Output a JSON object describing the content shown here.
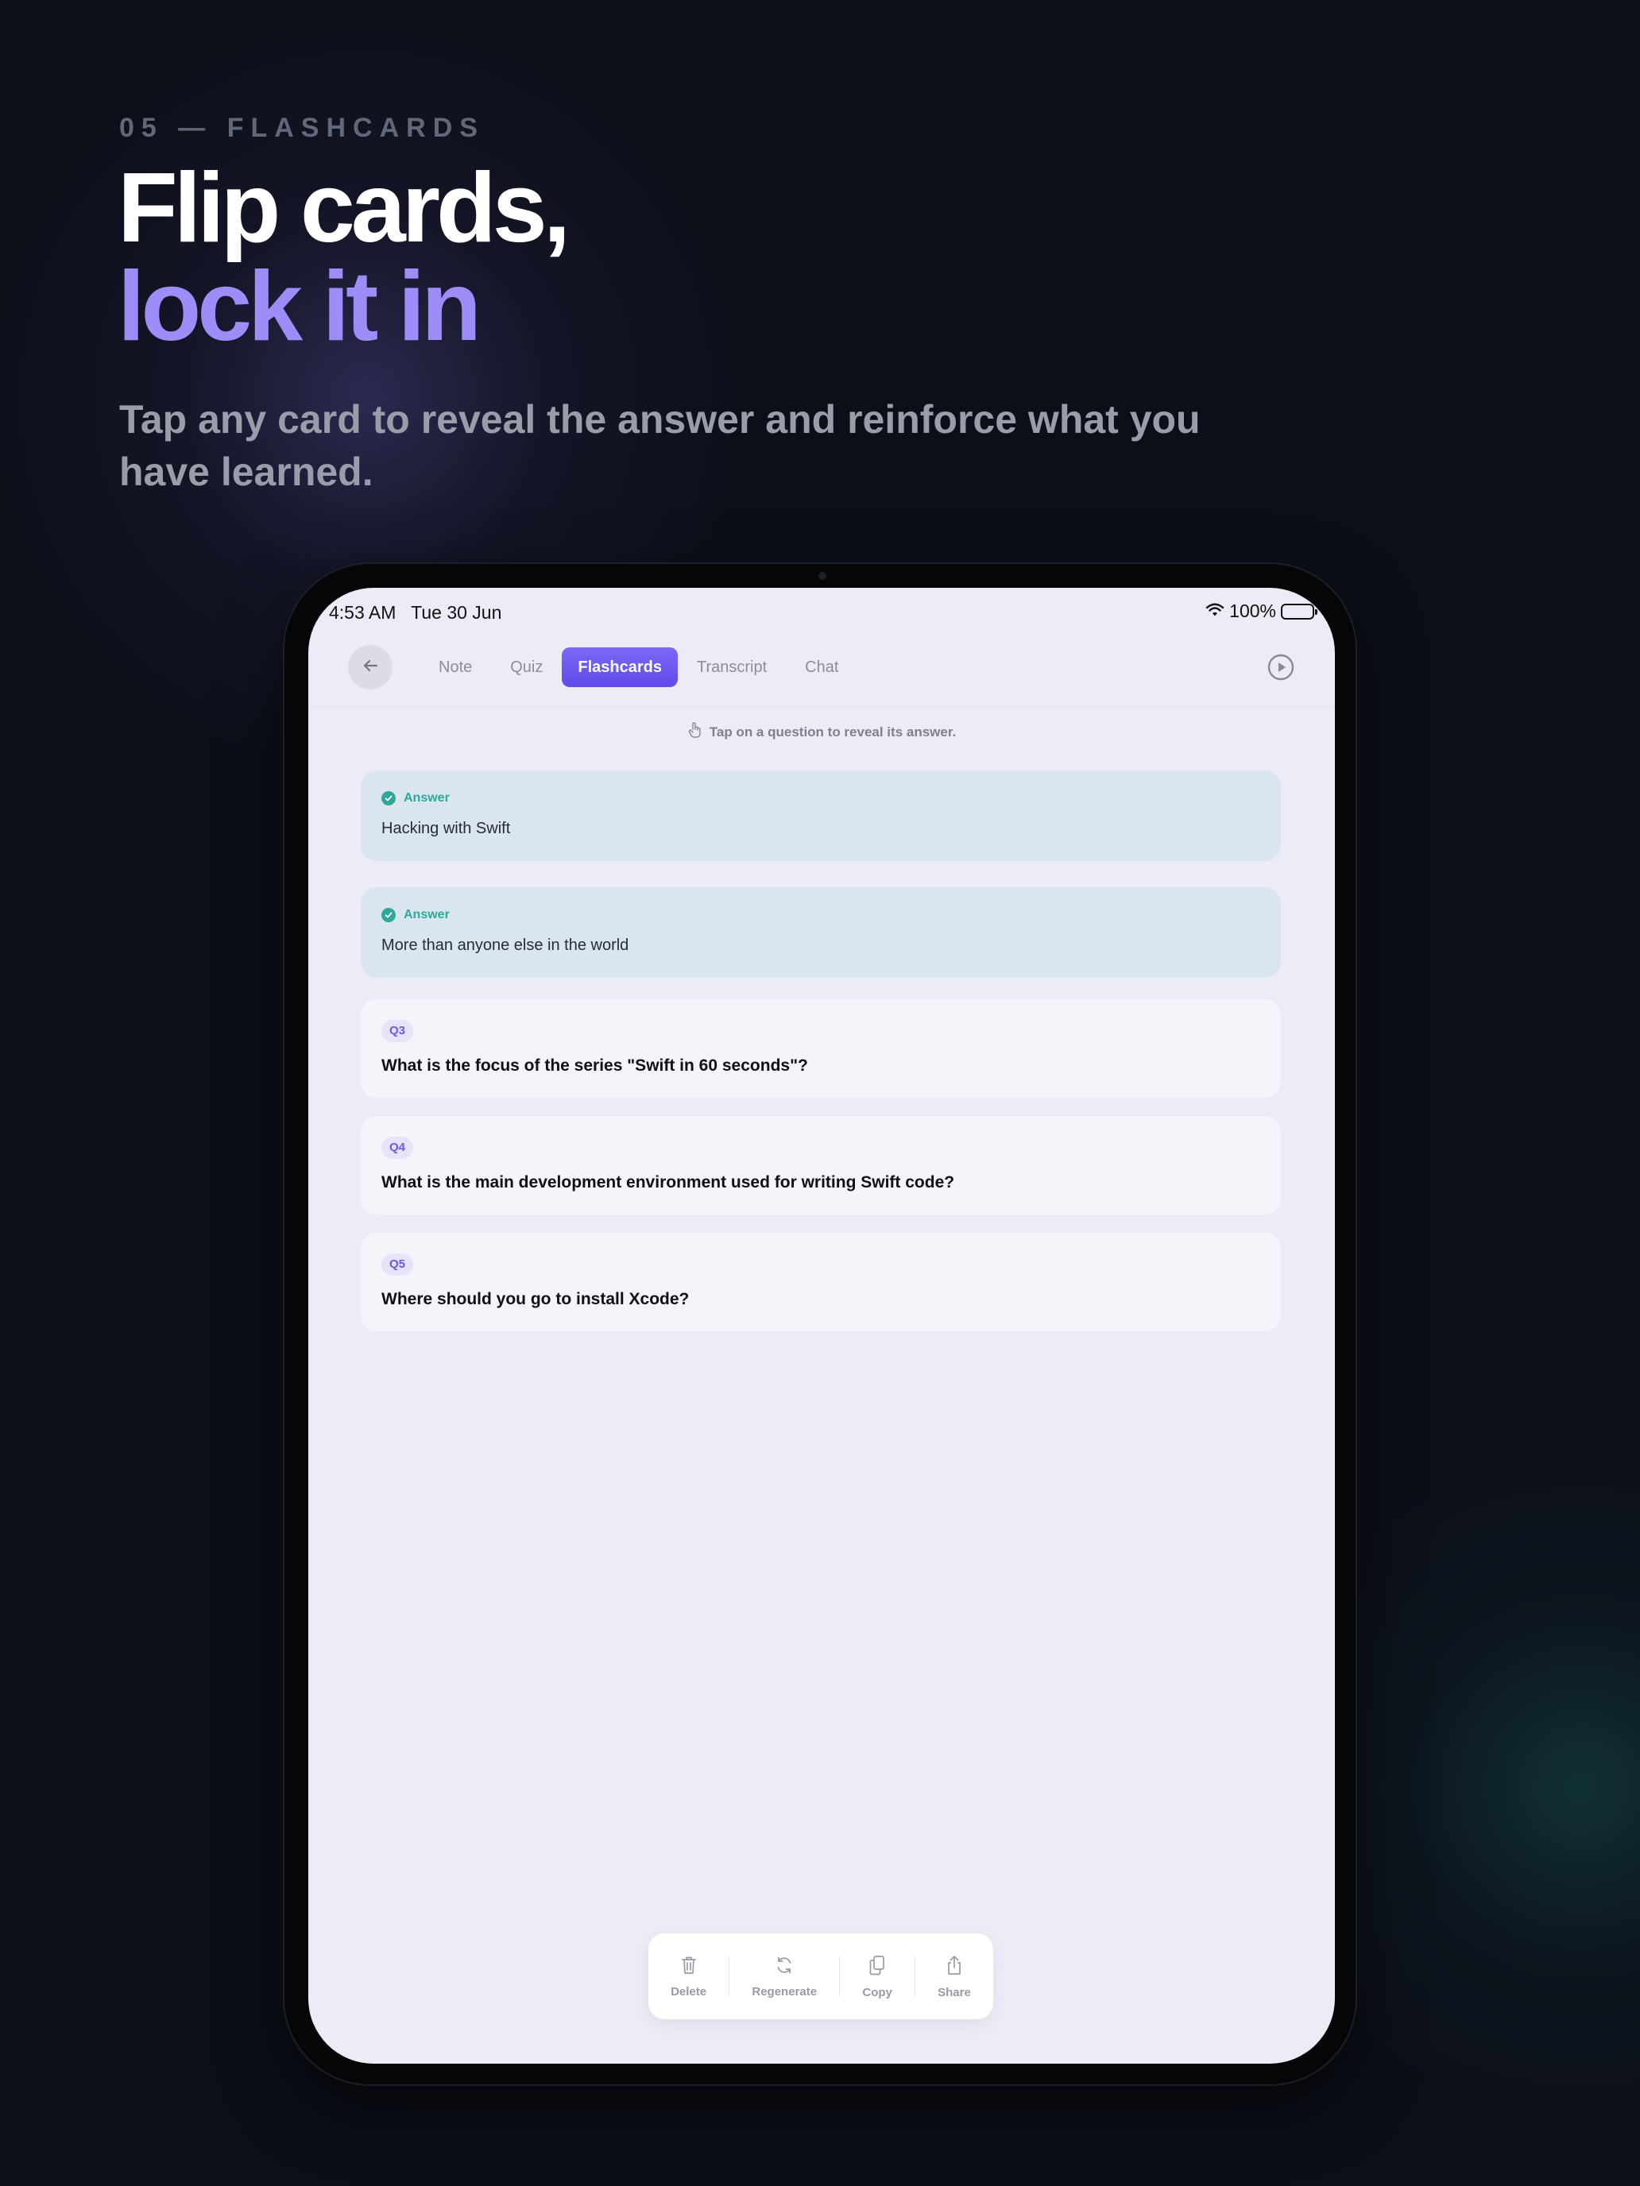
{
  "marketing": {
    "eyebrow": "05 — FLASHCARDS",
    "headline_line1": "Flip cards,",
    "headline_line2": "lock it in",
    "subtitle": "Tap any card to reveal the answer and reinforce what you have learned."
  },
  "status_bar": {
    "time": "4:53 AM",
    "date": "Tue 30 Jun",
    "battery": "100%"
  },
  "nav": {
    "back_icon": "arrow-left-icon",
    "tabs": [
      {
        "label": "Note",
        "active": false
      },
      {
        "label": "Quiz",
        "active": false
      },
      {
        "label": "Flashcards",
        "active": true
      },
      {
        "label": "Transcript",
        "active": false
      },
      {
        "label": "Chat",
        "active": false
      }
    ],
    "play_icon": "play-circle-icon"
  },
  "hint": "Tap on a question to reveal its answer.",
  "cards": [
    {
      "type": "answer",
      "label": "Answer",
      "text": "Hacking with Swift"
    },
    {
      "type": "answer",
      "label": "Answer",
      "text": "More than anyone else in the world"
    },
    {
      "type": "question",
      "badge": "Q3",
      "text": "What is the focus of the series \"Swift in 60 seconds\"?"
    },
    {
      "type": "question",
      "badge": "Q4",
      "text": "What is the main development environment used for writing Swift code?"
    },
    {
      "type": "question",
      "badge": "Q5",
      "text": "Where should you go to install Xcode?"
    }
  ],
  "toolbar": {
    "delete": "Delete",
    "regenerate": "Regenerate",
    "copy": "Copy",
    "share": "Share"
  },
  "colors": {
    "accent": "#6b58ef",
    "answer_green": "#2fa89a",
    "headline_purple": "#9d8df9"
  }
}
